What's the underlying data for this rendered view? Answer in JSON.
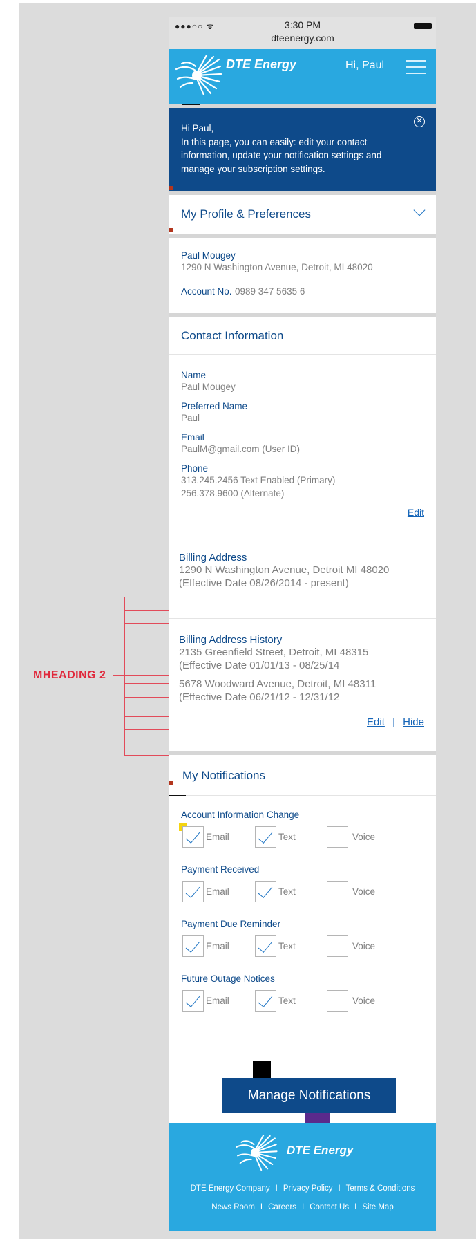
{
  "status_bar": {
    "signal": "●●●○○ ᯤ",
    "time": "3:30 PM",
    "url": "dteenergy.com"
  },
  "header": {
    "brand": "DTE Energy",
    "greeting": "Hi, Paul"
  },
  "banner": {
    "line1": "Hi Paul,",
    "line2": "In this page, you can easily: edit your contact information, update your notification settings and manage your subscription settings."
  },
  "profile_section": {
    "title": "My Profile & Preferences"
  },
  "account": {
    "name": "Paul Mougey",
    "address": "1290 N Washington Avenue, Detroit, MI 48020",
    "account_label": "Account No.",
    "account_number": "0989 347 5635 6"
  },
  "contact": {
    "title": "Contact Information",
    "name_label": "Name",
    "name_value": "Paul Mougey",
    "preferred_label": "Preferred Name",
    "preferred_value": "Paul",
    "email_label": "Email",
    "email_value": "PaulM@gmail.com (User ID)",
    "phone_label": "Phone",
    "phone_primary": "313.245.2456 Text Enabled (Primary)",
    "phone_alternate": "256.378.9600 (Alternate)",
    "edit_link": "Edit"
  },
  "billing": {
    "label": "Billing Address",
    "address": "1290 N Washington Avenue, Detroit MI 48020",
    "effective": "(Effective Date 08/26/2014 - present)"
  },
  "billing_history": {
    "label": "Billing Address History",
    "entries": [
      {
        "address": "2135 Greenfield Street, Detroit, MI 48315",
        "effective": "(Effective Date 01/01/13 - 08/25/14"
      },
      {
        "address": "5678 Woodward Avenue, Detroit, MI 48311",
        "effective": "(Effective Date 06/21/12 - 12/31/12"
      }
    ],
    "edit_link": "Edit",
    "separator": "|",
    "hide_link": "Hide"
  },
  "annotation": {
    "label": "MHEADING 2"
  },
  "notifications": {
    "title": "My Notifications",
    "option_labels": {
      "email": "Email",
      "text": "Text",
      "voice": "Voice"
    },
    "groups": [
      {
        "label": "Account Information Change",
        "email": true,
        "text": true,
        "voice": false
      },
      {
        "label": "Payment Received",
        "email": true,
        "text": true,
        "voice": false
      },
      {
        "label": "Payment Due Reminder",
        "email": true,
        "text": true,
        "voice": false
      },
      {
        "label": "Future Outage Notices",
        "email": true,
        "text": true,
        "voice": false
      }
    ],
    "manage_button": "Manage Notifications"
  },
  "footer": {
    "brand": "DTE Energy",
    "links_row1": [
      "DTE Energy Company",
      "Privacy Policy",
      "Terms & Conditions"
    ],
    "links_row2": [
      "News Room",
      "Careers",
      "Contact Us",
      "Site Map"
    ],
    "separator": "I"
  },
  "colors": {
    "header_blue": "#29a8e0",
    "navy": "#0e4a8a",
    "annotation_red": "#e0283b",
    "marker_yellow": "#f5d40f",
    "marker_green": "#1c7b48",
    "marker_purple": "#5a2a8c"
  }
}
